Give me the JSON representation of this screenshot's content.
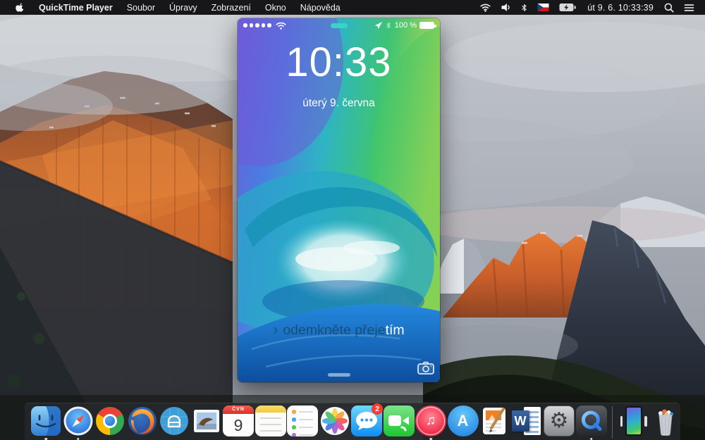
{
  "menu_bar": {
    "app_name": "QuickTime Player",
    "menus": [
      "Soubor",
      "Úpravy",
      "Zobrazení",
      "Okno",
      "Nápověda"
    ],
    "status_icons": [
      "wifi",
      "volume",
      "bluetooth",
      "czech-flag",
      "battery-charging",
      "spotlight",
      "notification-center"
    ],
    "clock": "út 9. 6. 10:33:39"
  },
  "phone_mirror": {
    "status_bar": {
      "signal_dots": 5,
      "icons": [
        "wifi",
        "location-arrow",
        "bluetooth",
        "battery-full"
      ],
      "battery_percent": "100 %"
    },
    "lock_screen": {
      "time": "10:33",
      "date": "úterý 9. června",
      "unlock_chevron": "›",
      "unlock_text": "odemkněte přejetím",
      "unlock_text_dim": "odemkněte přeje",
      "unlock_text_bright": "tím"
    }
  },
  "dock": {
    "items": [
      "finder",
      "safari",
      "chrome",
      "firefox",
      "mailbox",
      "mail",
      "calendar",
      "notes",
      "reminders",
      "photos",
      "messages",
      "facetime",
      "itunes",
      "app-store",
      "pages",
      "word",
      "system-preferences",
      "quicktime-player",
      "iphone-mirror-window",
      "trash"
    ],
    "running": [
      "finder",
      "safari",
      "photos",
      "itunes",
      "quicktime-player"
    ],
    "calendar_month": "ČVN",
    "calendar_day": "9",
    "messages_badge": "2",
    "word_letter": "W",
    "appstore_letter": "A"
  },
  "glyphs": {
    "itunes_note": "♫",
    "gear": "⚙"
  },
  "colors": {
    "menu_bar_bg": "#18181a",
    "dock_bg": "rgba(38,40,44,0.85)",
    "status_pill_teal": "#3ad3c8",
    "badge_red": "#ff3b30",
    "czech_flag_blue": "#11457e",
    "czech_flag_red": "#d7141a"
  }
}
